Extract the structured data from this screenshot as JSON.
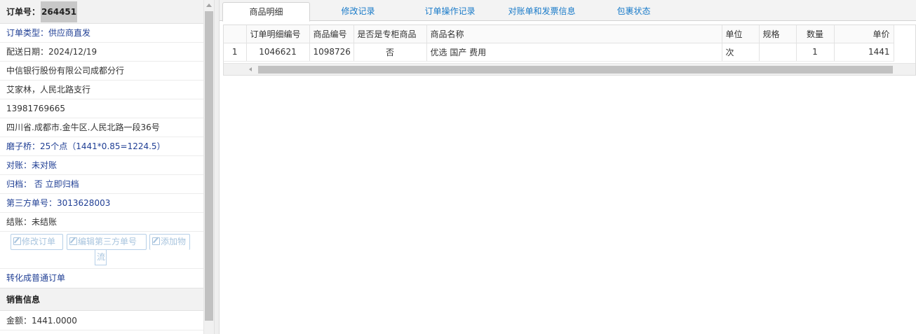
{
  "order": {
    "label": "订单号：",
    "number": "264451"
  },
  "info_rows": [
    {
      "text": "订单类型：供应商直发",
      "color": "#1f3e94"
    },
    {
      "text": "配送日期：2024/12/19",
      "color": "#333333"
    },
    {
      "text": "中信银行股份有限公司成都分行",
      "color": "#333333"
    },
    {
      "text": "艾家林，人民北路支行",
      "color": "#333333"
    },
    {
      "text": "13981769665",
      "color": "#333333"
    },
    {
      "text": "四川省.成都市.金牛区.人民北路一段36号",
      "color": "#333333"
    },
    {
      "text": "磨子桥：25个点（1441*0.85=1224.5）",
      "color": "#1f3e94"
    },
    {
      "text": "对账：未对账",
      "color": "#1f3e94"
    },
    {
      "text": "归档： 否 立即归档",
      "color": "#1f3e94"
    },
    {
      "text": "第三方单号：3013628003",
      "color": "#1f3e94"
    },
    {
      "text": "结账：未结账",
      "color": "#333333"
    }
  ],
  "actions": {
    "edit_order": "修改订单",
    "edit_third_party": "编辑第三方单号",
    "add_logistics_line1": "添加物",
    "add_logistics_line2": "流"
  },
  "convert_link": "转化成普通订单",
  "sales_section": {
    "title": "销售信息",
    "amount": "金额：1441.0000"
  },
  "tabs": [
    {
      "label": "商品明细",
      "active": true
    },
    {
      "label": "修改记录",
      "active": false
    },
    {
      "label": "订单操作记录",
      "active": false
    },
    {
      "label": "对账单和发票信息",
      "active": false
    },
    {
      "label": "包裹状态",
      "active": false
    }
  ],
  "grid": {
    "columns": [
      "",
      "订单明细编号",
      "商品编号",
      "是否是专柜商品",
      "商品名称",
      "单位",
      "规格",
      "数量",
      "单价"
    ],
    "rows": [
      [
        "1",
        "1046621",
        "1098726",
        "否",
        "优选 国产 费用",
        "次",
        "",
        "1",
        "1441"
      ]
    ]
  },
  "colors": {
    "accent_blue": "#1f3e94",
    "tab_blue": "#1a7bc9"
  }
}
